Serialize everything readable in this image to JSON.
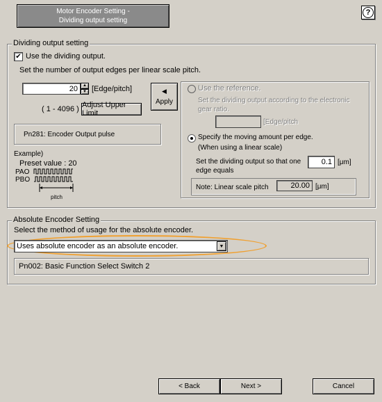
{
  "header": {
    "title_line1": "Motor Encoder Setting -",
    "title_line2": "Dividing output setting",
    "help_icon": "?"
  },
  "dividing": {
    "group_label": "Dividing output setting",
    "use_checkbox_label": "Use the dividing output.",
    "use_checked": true,
    "instruction": "Set the number of output edges per linear scale pitch.",
    "edges_value": "20",
    "edges_unit": "[Edge/pitch]",
    "range": "( 1 - 4096 )",
    "adjust_button": "Adjust Upper Limit",
    "apply_button": "Apply",
    "param_box": "Pn281: Encoder Output pulse",
    "example_label": "Example)",
    "preset_label": "Preset value : 20",
    "pao_label": "PAO",
    "pbo_label": "PBO",
    "pitch_label": "pitch",
    "ref_radio_label": "Use the reference.",
    "ref_desc": "Set the dividing output according to the electronic gear ratio.",
    "ref_value": "",
    "ref_unit": "[Edge/pitch",
    "amount_radio_label": "Specify the moving amount per edge.",
    "amount_radio_sub": "(When using a linear scale)",
    "amount_desc": "Set the dividing output so that one edge equals",
    "amount_value": "0.1",
    "amount_unit": "[μm]",
    "note_label": "Note: Linear scale pitch",
    "note_value": "20.00",
    "note_unit": "[μm]"
  },
  "absolute": {
    "group_label": "Absolute Encoder Setting",
    "instruction": "Select the method of usage for the absolute encoder.",
    "selected": "Uses absolute encoder as an absolute encoder.",
    "param_box": "Pn002: Basic Function Select Switch 2"
  },
  "footer": {
    "back": "< Back",
    "next": "Next >",
    "cancel": "Cancel"
  }
}
